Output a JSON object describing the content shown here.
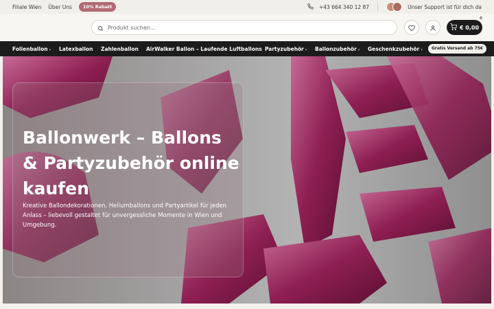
{
  "topbar": {
    "store_link": "Filiale Wien",
    "about_link": "Über Uns",
    "discount_badge": "10% Rabatt",
    "phone": "+43 664 340 12 87",
    "support_text": "Unser Support ist für dich da"
  },
  "header": {
    "search_placeholder": "Produkt suchen...",
    "cart_total": "€ 0,00",
    "cart_count": "0"
  },
  "nav": {
    "items": [
      {
        "label": "Folienballon",
        "has_dropdown": true
      },
      {
        "label": "Latexballon",
        "has_dropdown": false
      },
      {
        "label": "Zahlenballon",
        "has_dropdown": false
      },
      {
        "label": "AirWalker Ballon – Laufende Luftballons",
        "has_dropdown": false
      },
      {
        "label": "Partyzubehör",
        "has_dropdown": true
      },
      {
        "label": "Ballonzubehör",
        "has_dropdown": true
      },
      {
        "label": "Geschenkzubehör",
        "has_dropdown": true
      }
    ],
    "shipping_badge": "Gratis Versand ab 75€"
  },
  "hero": {
    "title": "Ballonwerk – Ballons & Partyzubehör online kaufen",
    "text": "Kreative Ballondekorationen, Heliumballons und Partyartikel für jeden Anlass – liebevoll gestaltet für unvergessliche Momente in Wien und Umgebung."
  },
  "colors": {
    "nav_bg": "#1c1c1c",
    "badge_bg": "#b26a74",
    "balloon": "#8e1f52",
    "hero_bg": "#a9a9a9"
  }
}
